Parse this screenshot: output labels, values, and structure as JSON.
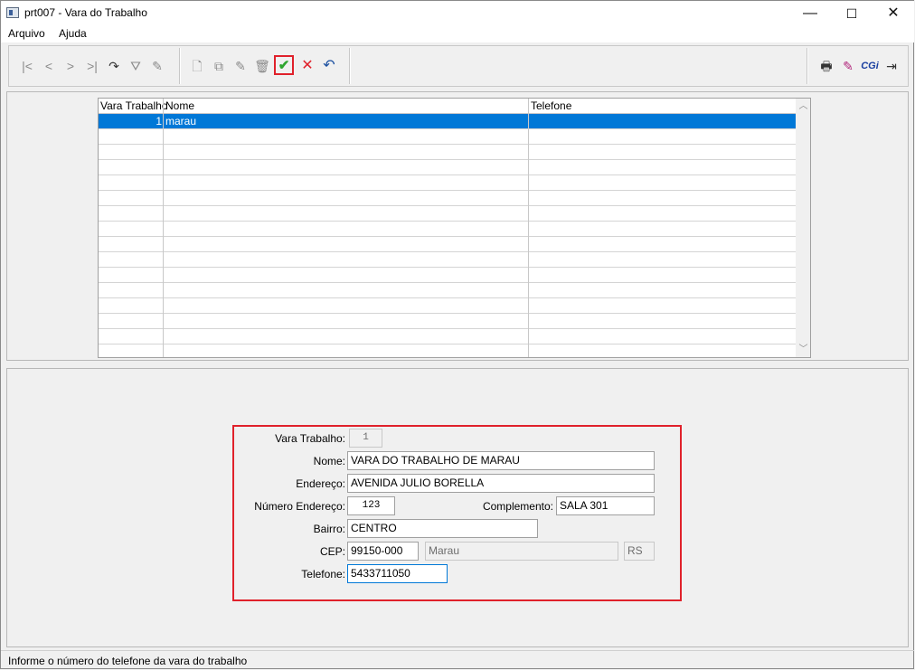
{
  "window": {
    "title": "prt007 - Vara do Trabalho",
    "minimize": "—",
    "maximize": "☐",
    "close": "✕"
  },
  "menu": [
    "Arquivo",
    "Ajuda"
  ],
  "toolbar": {
    "nav": [
      "|<",
      "<",
      ">",
      ">|",
      "↷",
      "⛛",
      "✎"
    ],
    "edit": [
      "🗋",
      "⧉",
      "✎",
      "🗑",
      "✔",
      "✕",
      "↶"
    ],
    "right": [
      "🖶",
      "✎",
      "CGi",
      "⇥"
    ]
  },
  "grid": {
    "columns": [
      "Vara Trabalho",
      "Nome",
      "Telefone"
    ],
    "rows": [
      {
        "vara": "1",
        "nome": "marau",
        "telefone": ""
      }
    ]
  },
  "form": {
    "vara_label": "Vara Trabalho:",
    "vara_value": "1",
    "nome_label": "Nome:",
    "nome_value": "VARA DO TRABALHO DE MARAU",
    "endereco_label": "Endereço:",
    "endereco_value": "AVENIDA JULIO BORELLA",
    "numero_label": "Número Endereço:",
    "numero_value": "123",
    "complemento_label": "Complemento:",
    "complemento_value": "SALA 301",
    "bairro_label": "Bairro:",
    "bairro_value": "CENTRO",
    "cep_label": "CEP:",
    "cep_value": "99150-000",
    "cidade_value": "Marau",
    "uf_value": "RS",
    "telefone_label": "Telefone:",
    "telefone_value": "5433711050"
  },
  "status": "Informe o número do telefone da vara do trabalho",
  "colors": {
    "selection": "#0078d7",
    "highlight_border": "#e0212b",
    "confirm": "#2fa52f",
    "cancel": "#e0212b"
  }
}
